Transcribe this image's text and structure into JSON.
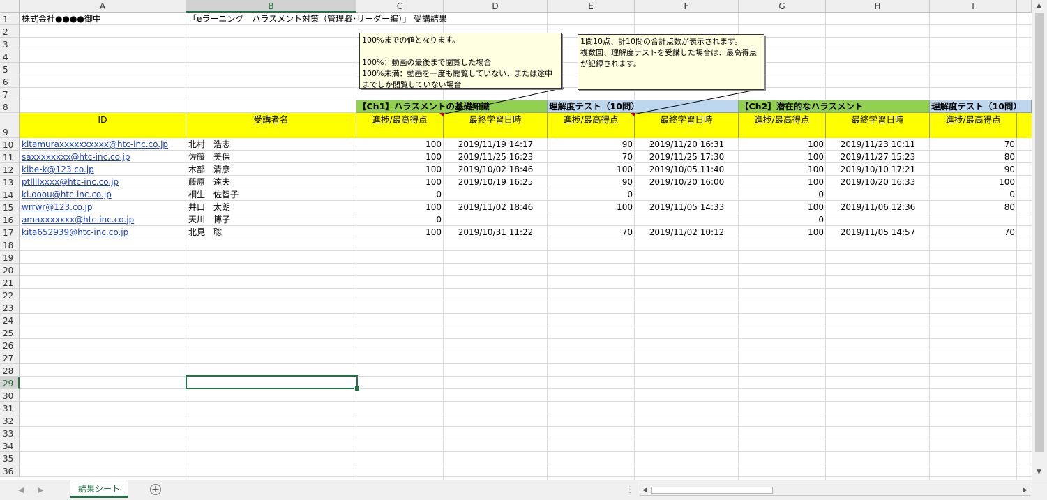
{
  "columns": [
    "A",
    "B",
    "C",
    "D",
    "E",
    "F",
    "G",
    "H",
    "I"
  ],
  "rows": [
    "1",
    "2",
    "3",
    "4",
    "5",
    "6",
    "7",
    "8",
    "9",
    "10",
    "11",
    "12",
    "13",
    "14",
    "15",
    "16",
    "17",
    "18",
    "19",
    "20",
    "21",
    "22",
    "23",
    "24",
    "25",
    "26",
    "27",
    "28",
    "29",
    "30",
    "31",
    "32",
    "33",
    "34",
    "35",
    "36"
  ],
  "title_a1": "株式会社●●●●御中",
  "title_b1": "「eラーニング　ハラスメント対策（管理職･リーダー編）」 受講結果",
  "group_headers": {
    "ch1": "【Ch1】ハラスメントの基礎知識",
    "test1": "理解度テスト（10問）",
    "ch2": "【Ch2】潜在的なハラスメント",
    "test2": "理解度テスト（10問）"
  },
  "col_headers": {
    "id": "ID",
    "name": "受講者名",
    "progress1": "進捗/最高得点",
    "date1": "最終学習日時",
    "progress2": "進捗/最高得点",
    "date2": "最終学習日時",
    "progress3": "進捗/最高得点",
    "date3": "最終学習日時",
    "progress4": "進捗/最高得点"
  },
  "records": [
    {
      "id": "kitamuraxxxxxxxxxx@htc-inc.co.jp",
      "name": "北村　浩志",
      "c": "100",
      "d": "2019/11/19 14:17",
      "e": "90",
      "f": "2019/11/20 16:31",
      "g": "100",
      "h": "2019/11/23 10:11",
      "i": "70"
    },
    {
      "id": "saxxxxxxxx@htc-inc.co.jp",
      "name": "佐藤　美保",
      "c": "100",
      "d": "2019/11/25 16:23",
      "e": "70",
      "f": "2019/11/25 17:30",
      "g": "100",
      "h": "2019/11/27 15:23",
      "i": "80"
    },
    {
      "id": "kibe-k@123.co.jp",
      "name": "木部　清彦",
      "c": "100",
      "d": "2019/10/02 18:46",
      "e": "100",
      "f": "2019/10/05 11:40",
      "g": "100",
      "h": "2019/10/10 17:21",
      "i": "90"
    },
    {
      "id": "ptllllxxxx@htc-inc.co.jp",
      "name": "藤原　達夫",
      "c": "100",
      "d": "2019/10/19 16:25",
      "e": "90",
      "f": "2019/10/20 16:00",
      "g": "100",
      "h": "2019/10/20 16:33",
      "i": "100"
    },
    {
      "id": "ki.ooou@htc-inc.co.jp",
      "name": "桐生　佐智子",
      "c": "0",
      "d": "",
      "e": "0",
      "f": "",
      "g": "0",
      "h": "",
      "i": "0"
    },
    {
      "id": "wrrwr@123.co.jp",
      "name": "井口　太朗",
      "c": "100",
      "d": "2019/11/02 18:46",
      "e": "100",
      "f": "2019/11/05 14:33",
      "g": "100",
      "h": "2019/11/06 12:36",
      "i": "80"
    },
    {
      "id": "amaxxxxxxx@htc-inc.co.jp",
      "name": "天川　博子",
      "c": "0",
      "d": "",
      "e": "",
      "f": "",
      "g": "0",
      "h": "",
      "i": ""
    },
    {
      "id": "kita652939@htc-inc.co.jp",
      "name": "北見　聡",
      "c": "100",
      "d": "2019/10/31 11:22",
      "e": "70",
      "f": "2019/11/02 10:12",
      "g": "100",
      "h": "2019/11/05 14:57",
      "i": "70"
    }
  ],
  "comments": {
    "progress_note": "100%までの値となります。\n\n100%：動画の最後まで閲覧した場合\n100%未満：動画を一度も閲覧していない、または途中までしか閲覧していない場合",
    "test_note": "1問10点、計10問の合計点数が表示されます。\n複数回、理解度テストを受講した場合は、最高得点が記録されます。"
  },
  "sheet_tab": "結果シート",
  "add_sheet_symbol": "+",
  "selected_cell": "B29",
  "colors": {
    "yellow": "#ffff00",
    "green": "#92d050",
    "blue": "#bdd7ee",
    "excel_green": "#217346"
  }
}
